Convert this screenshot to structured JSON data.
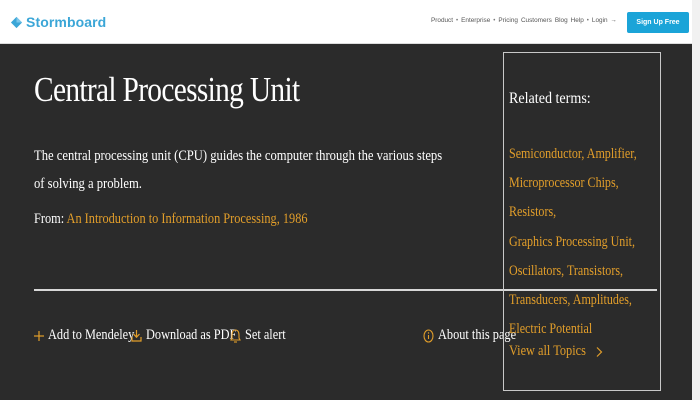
{
  "brand": {
    "name": "Stormboard"
  },
  "nav": {
    "items": [
      "Product",
      "Enterprise",
      "Pricing",
      "Customers",
      "Blog",
      "Help",
      "Login"
    ],
    "login_arrow": "→",
    "signup_label": "Sign Up Free"
  },
  "article": {
    "title": "Central Processing Unit",
    "description": "The central processing unit (CPU) guides the computer through the various steps of solving a problem.",
    "from_label": "From:",
    "source_title": "An Introduction to Information Processing, 1986"
  },
  "actions": {
    "mendeley": "Add to Mendeley",
    "pdf": "Download as PDF",
    "alert": "Set alert",
    "about": "About this page"
  },
  "related": {
    "heading": "Related terms:",
    "terms": [
      "Semiconductor",
      "Amplifier",
      "Microprocessor Chips",
      "Resistors",
      "Graphics Processing Unit",
      "Oscillators",
      "Transistors",
      "Transducers",
      "Amplitudes",
      "Electric Potential"
    ],
    "view_all": "View all Topics"
  },
  "icons": {
    "logo": "stormboard-logo-icon",
    "mendeley": "plus-icon",
    "pdf": "download-icon",
    "alert": "bell-icon",
    "about": "info-icon",
    "view_all": "chevron-right-icon"
  },
  "colors": {
    "background": "#2b2b2b",
    "accent": "#e29e2a",
    "brand": "#3ba6d7",
    "signup": "#1ba4d8"
  }
}
